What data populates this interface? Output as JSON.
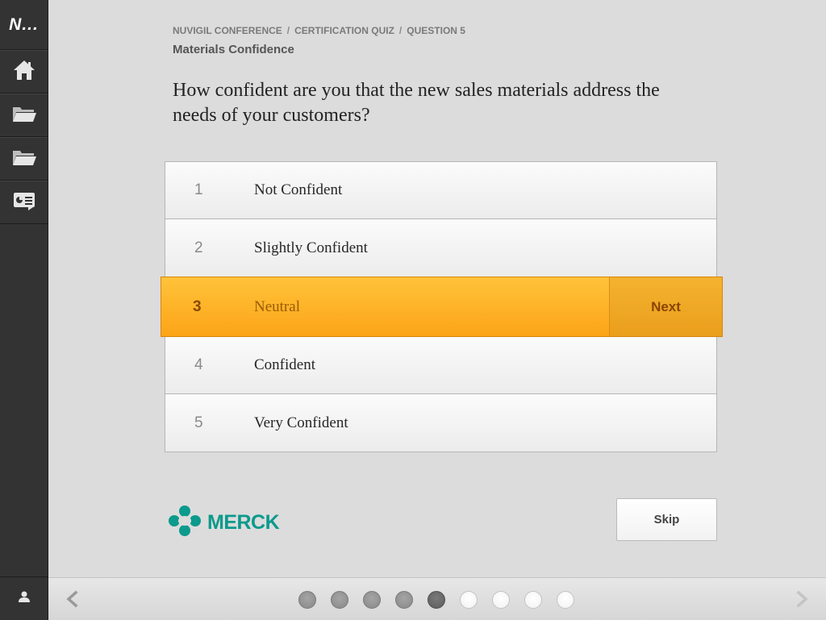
{
  "sidebar": {
    "logo_text": "N...",
    "items": [
      {
        "icon": "home-icon"
      },
      {
        "icon": "folder-icon"
      },
      {
        "icon": "folder-icon"
      },
      {
        "icon": "presentation-icon"
      }
    ],
    "user_icon": "user-icon"
  },
  "header": {
    "breadcrumb": [
      "NUVIGIL CONFERENCE",
      "CERTIFICATION QUIZ",
      "QUESTION 5"
    ],
    "breadcrumb_separator": "/",
    "subtitle": "Materials Confidence"
  },
  "question": "How confident are you that the new sales materials address the needs of your customers?",
  "options": [
    {
      "number": "1",
      "label": "Not Confident",
      "selected": false
    },
    {
      "number": "2",
      "label": "Slightly Confident",
      "selected": false
    },
    {
      "number": "3",
      "label": "Neutral",
      "selected": true
    },
    {
      "number": "4",
      "label": "Confident",
      "selected": false
    },
    {
      "number": "5",
      "label": "Very Confident",
      "selected": false
    }
  ],
  "next_label": "Next",
  "skip_label": "Skip",
  "brand": {
    "name": "MERCK",
    "color": "#0b9a8c"
  },
  "pagination": {
    "total": 9,
    "current": 5,
    "states": [
      "done",
      "done",
      "done",
      "done",
      "current",
      "todo",
      "todo",
      "todo",
      "todo"
    ]
  },
  "colors": {
    "selected_bg": "#fcb227",
    "sidebar_bg": "#333333",
    "page_bg": "#dcdcdc"
  }
}
